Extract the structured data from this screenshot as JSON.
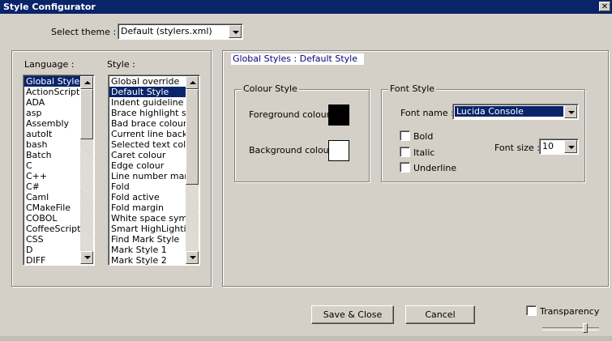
{
  "window": {
    "title": "Style Configurator",
    "close_glyph": "✕"
  },
  "theme": {
    "label": "Select theme :",
    "value": "Default (stylers.xml)"
  },
  "language": {
    "label": "Language :",
    "selected": "Global Styles",
    "items": [
      "Global Styles",
      "ActionScript",
      "ADA",
      "asp",
      "Assembly",
      "autoIt",
      "bash",
      "Batch",
      "C",
      "C++",
      "C#",
      "Caml",
      "CMakeFile",
      "COBOL",
      "CoffeeScript",
      "CSS",
      "D",
      "DIFF"
    ]
  },
  "style": {
    "label": "Style :",
    "selected": "Default Style",
    "items": [
      "Global override",
      "Default Style",
      "Indent guideline sty",
      "Brace highlight style",
      "Bad brace colour",
      "Current line backgro",
      "Selected text colour",
      "Caret colour",
      "Edge colour",
      "Line number margin",
      "Fold",
      "Fold active",
      "Fold margin",
      "White space symbo",
      "Smart HighLighting",
      "Find Mark Style",
      "Mark Style 1",
      "Mark Style 2"
    ]
  },
  "style_description": "Global Styles : Default Style",
  "colour_style": {
    "legend": "Colour Style",
    "foreground_label": "Foreground colour",
    "foreground_color": "#000000",
    "background_label": "Background colour",
    "background_color": "#ffffff"
  },
  "font_style": {
    "legend": "Font Style",
    "font_name_label": "Font name :",
    "font_name": "Lucida Console",
    "bold_label": "Bold",
    "italic_label": "Italic",
    "underline_label": "Underline",
    "font_size_label": "Font size :",
    "font_size": "10"
  },
  "buttons": {
    "save_close": "Save & Close",
    "cancel": "Cancel"
  },
  "transparency": {
    "label": "Transparency",
    "checked": false,
    "slider_value": 0.75
  },
  "colors": {
    "titlebar": "#0a246a",
    "selection": "#0a246a",
    "face": "#d4d0c8",
    "description_text": "#000080"
  }
}
